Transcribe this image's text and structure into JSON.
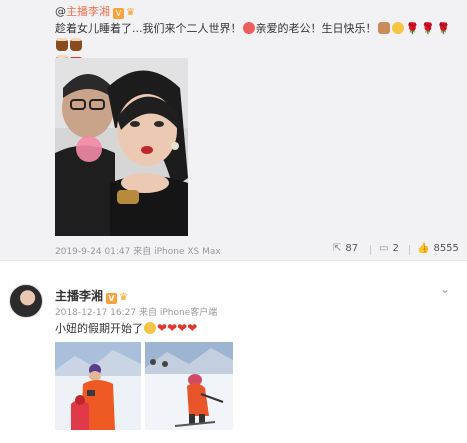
{
  "post1": {
    "header_prefix": "@",
    "author": "主播李湘",
    "badge": "V",
    "text": "趁着女儿睡着了...我们来个二人世界！",
    "text2": "亲爱的老公！生日快乐！",
    "timestamp": "2019-9-24 01:47",
    "source": "来自 iPhone XS Max",
    "reposts": "87",
    "comments": "2",
    "likes": "8555"
  },
  "post2": {
    "author": "主播李湘",
    "badge": "V",
    "timestamp": "2018-12-17 16:27",
    "source": "来自 iPhone客户端",
    "text": "小妞的假期开始了"
  },
  "colors": {
    "page_bg": "#f2f2f5",
    "author_orange": "#eb7350",
    "heart_red": "#e2352f"
  }
}
